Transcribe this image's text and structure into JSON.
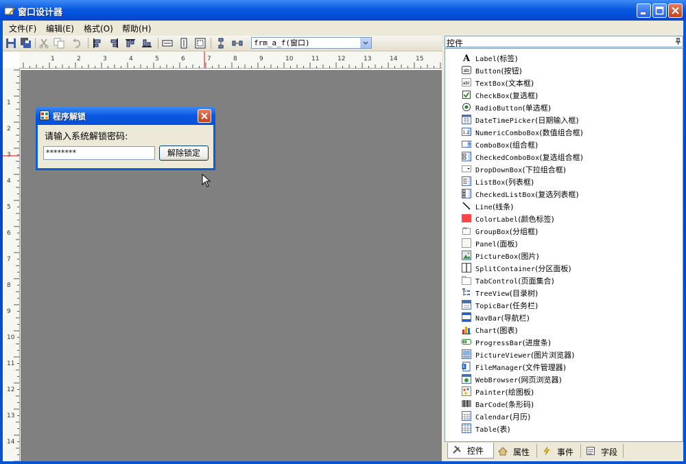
{
  "window": {
    "title": "窗口设计器"
  },
  "menu": [
    "文件(F)",
    "编辑(E)",
    "格式(O)",
    "帮助(H)"
  ],
  "toolbar": {
    "object_selector": "frm_a_f(窗口)"
  },
  "ruler": {
    "h_ticks": [
      "1",
      "2",
      "3",
      "4",
      "5",
      "6",
      "7",
      "8",
      "9",
      "10",
      "11",
      "12",
      "13",
      "14",
      "15"
    ],
    "v_ticks": [
      "1",
      "2",
      "3",
      "4",
      "5",
      "6",
      "7",
      "8",
      "9",
      "10",
      "11",
      "12",
      "13",
      "14"
    ]
  },
  "dialog": {
    "title": "程序解锁",
    "prompt": "请输入系统解锁密码:",
    "password_value": "********",
    "unlock_button": "解除锁定"
  },
  "panel": {
    "title": "控件",
    "pin_icon": "pin-icon",
    "controls": [
      {
        "en": "Label",
        "zh": "(标签)",
        "icon": "label-icon"
      },
      {
        "en": "Button",
        "zh": "(按钮)",
        "icon": "button-icon"
      },
      {
        "en": "TextBox",
        "zh": "(文本框)",
        "icon": "textbox-icon"
      },
      {
        "en": "CheckBox",
        "zh": "(复选框)",
        "icon": "checkbox-icon"
      },
      {
        "en": "RadioButton",
        "zh": "(单选框)",
        "icon": "radiobutton-icon"
      },
      {
        "en": "DateTimePicker",
        "zh": "(日期输入框)",
        "icon": "datetimepicker-icon"
      },
      {
        "en": "NumericComboBox",
        "zh": "(数值组合框)",
        "icon": "numericcombobox-icon"
      },
      {
        "en": "ComboBox",
        "zh": "(组合框)",
        "icon": "combobox-icon"
      },
      {
        "en": "CheckedComboBox",
        "zh": "(复选组合框)",
        "icon": "checkedcombobox-icon"
      },
      {
        "en": "DropDownBox",
        "zh": "(下拉组合框)",
        "icon": "dropdownbox-icon"
      },
      {
        "en": "ListBox",
        "zh": "(列表框)",
        "icon": "listbox-icon"
      },
      {
        "en": "CheckedListBox",
        "zh": "(复选列表框)",
        "icon": "checkedlistbox-icon"
      },
      {
        "en": "Line",
        "zh": "(线条)",
        "icon": "line-icon"
      },
      {
        "en": "ColorLabel",
        "zh": "(颜色标签)",
        "icon": "colorlabel-icon"
      },
      {
        "en": "GroupBox",
        "zh": "(分组框)",
        "icon": "groupbox-icon"
      },
      {
        "en": "Panel",
        "zh": "(面板)",
        "icon": "panel-icon"
      },
      {
        "en": "PictureBox",
        "zh": "(图片)",
        "icon": "picturebox-icon"
      },
      {
        "en": "SplitContainer",
        "zh": "(分区面板)",
        "icon": "splitcontainer-icon"
      },
      {
        "en": "TabControl",
        "zh": "(页面集合)",
        "icon": "tabcontrol-icon"
      },
      {
        "en": "TreeView",
        "zh": "(目录树)",
        "icon": "treeview-icon"
      },
      {
        "en": "TopicBar",
        "zh": "(任务栏)",
        "icon": "topicbar-icon"
      },
      {
        "en": "NavBar",
        "zh": "(导航栏)",
        "icon": "navbar-icon"
      },
      {
        "en": "Chart",
        "zh": "(图表)",
        "icon": "chart-icon"
      },
      {
        "en": "ProgressBar",
        "zh": "(进度条)",
        "icon": "progressbar-icon"
      },
      {
        "en": "PictureViewer",
        "zh": "(图片浏览器)",
        "icon": "pictureviewer-icon"
      },
      {
        "en": "FileManager",
        "zh": "(文件管理器)",
        "icon": "filemanager-icon"
      },
      {
        "en": "WebBrowser",
        "zh": "(网页浏览器)",
        "icon": "webbrowser-icon"
      },
      {
        "en": "Painter",
        "zh": "(绘图板)",
        "icon": "painter-icon"
      },
      {
        "en": "BarCode",
        "zh": "(条形码)",
        "icon": "barcode-icon"
      },
      {
        "en": "Calendar",
        "zh": "(月历)",
        "icon": "calendar-icon"
      },
      {
        "en": "Table",
        "zh": "(表)",
        "icon": "table-icon"
      }
    ],
    "tabs": [
      {
        "label": "控件",
        "icon": "tools-icon",
        "active": true
      },
      {
        "label": "属性",
        "icon": "properties-icon",
        "active": false
      },
      {
        "label": "事件",
        "icon": "lightning-icon",
        "active": false
      },
      {
        "label": "字段",
        "icon": "field-icon",
        "active": false
      }
    ]
  },
  "colors": {
    "xp_blue": "#0a5cd8",
    "canvas_gray": "#808080",
    "face": "#ece9d8",
    "close_red": "#c8401c"
  }
}
